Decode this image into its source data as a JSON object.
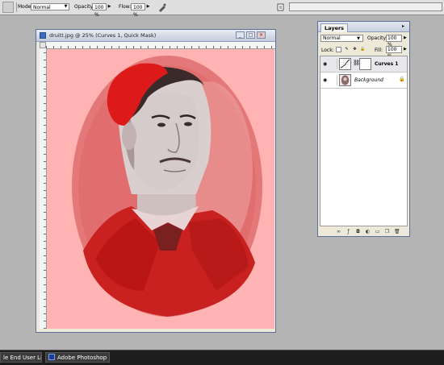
{
  "options_bar": {
    "mode_label": "Mode:",
    "mode_value": "Normal",
    "opacity_label": "Opacity:",
    "opacity_value": "100 %",
    "flow_label": "Flow:",
    "flow_value": "100 %",
    "tool_icon": "brush-icon",
    "airbrush_icon": "airbrush-icon",
    "palette_icon": "palette-well-icon"
  },
  "document": {
    "title": "druitt.jpg @ 25% (Curves 1, Quick Mask)",
    "icon": "photoshop-doc-icon",
    "mask_color": "#ffb3b3"
  },
  "layers_panel": {
    "tab_label": "Layers",
    "blend_mode": "Normal",
    "opacity_label": "Opacity:",
    "opacity_value": "100 %",
    "lock_label": "Lock:",
    "fill_label": "Fill:",
    "fill_value": "100 %",
    "layers": [
      {
        "name": "Curves 1",
        "type": "adjustment"
      },
      {
        "name": "Background",
        "type": "image",
        "locked": true
      }
    ],
    "footer_icons": [
      "link-layers-icon",
      "layer-style-icon",
      "layer-mask-icon",
      "adjustment-layer-icon",
      "group-icon",
      "new-layer-icon",
      "trash-icon"
    ]
  },
  "taskbar": {
    "items": [
      {
        "label": "le End User Lic..."
      },
      {
        "label": "Adobe Photoshop"
      }
    ]
  }
}
